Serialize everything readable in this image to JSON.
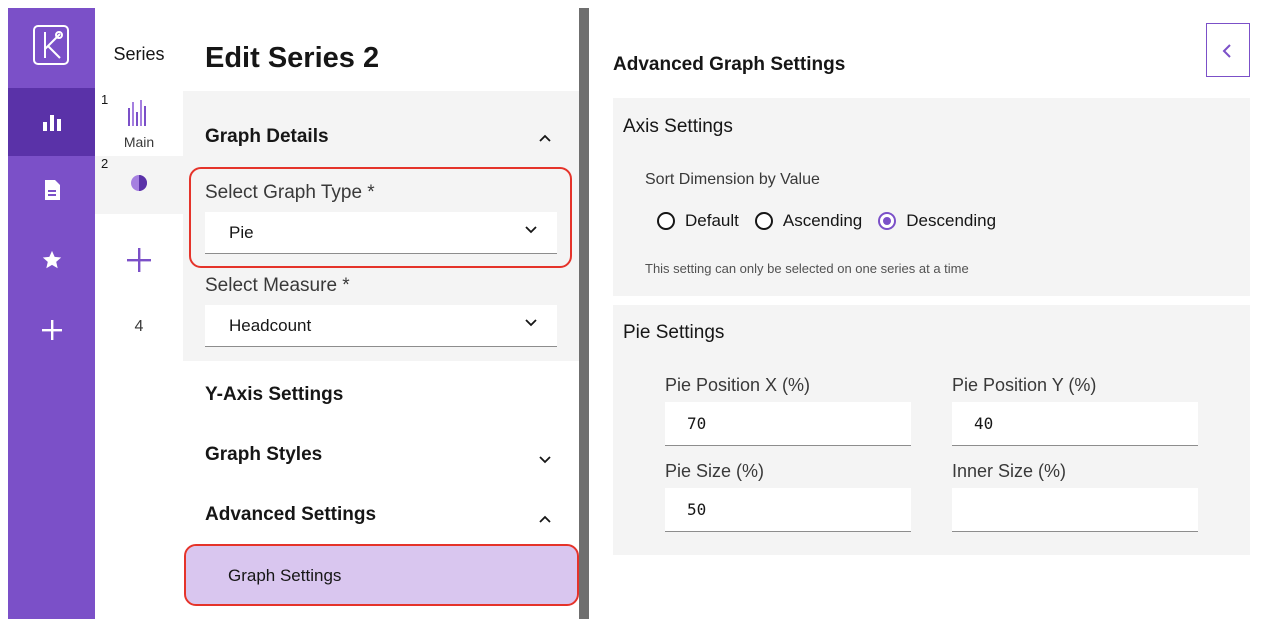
{
  "rail": {
    "items": [
      {
        "icon": "bar-chart-icon",
        "active": true
      },
      {
        "icon": "document-icon",
        "active": false
      },
      {
        "icon": "star-icon",
        "active": false
      },
      {
        "icon": "plus-icon",
        "active": false
      }
    ],
    "colors": {
      "rail": "#7b50c8",
      "active": "#5a32a8"
    }
  },
  "series": {
    "title": "Series",
    "items": [
      {
        "number": "1",
        "label": "Main",
        "icon": "bar-series-icon"
      },
      {
        "number": "2",
        "label": "",
        "icon": "pie-series-icon"
      }
    ],
    "count": "4"
  },
  "edit": {
    "title": "Edit Series 2",
    "graph_details": "Graph Details",
    "graph_type_label": "Select Graph Type *",
    "graph_type_value": "Pie",
    "measure_label": "Select Measure  *",
    "measure_value": "Headcount",
    "y_axis_settings": "Y-Axis Settings",
    "graph_styles": "Graph Styles",
    "advanced_settings": "Advanced Settings",
    "graph_settings": "Graph Settings"
  },
  "advanced": {
    "title": "Advanced Graph Settings",
    "axis": {
      "title": "Axis Settings",
      "sort_label": "Sort Dimension by Value",
      "options": [
        "Default",
        "Ascending",
        "Descending"
      ],
      "selected": "Descending",
      "helper": "This setting can only be selected on one series at a time"
    },
    "pie": {
      "title": "Pie Settings",
      "pos_x_label": "Pie Position X (%)",
      "pos_x_value": "70",
      "pos_y_label": "Pie Position Y (%)",
      "pos_y_value": "40",
      "size_label": "Pie Size (%)",
      "size_value": "50",
      "inner_label": "Inner Size (%)",
      "inner_value": ""
    }
  },
  "colors": {
    "accent": "#7b50c8",
    "highlight": "#e5332a",
    "selected_item": "#d9c6ef"
  }
}
